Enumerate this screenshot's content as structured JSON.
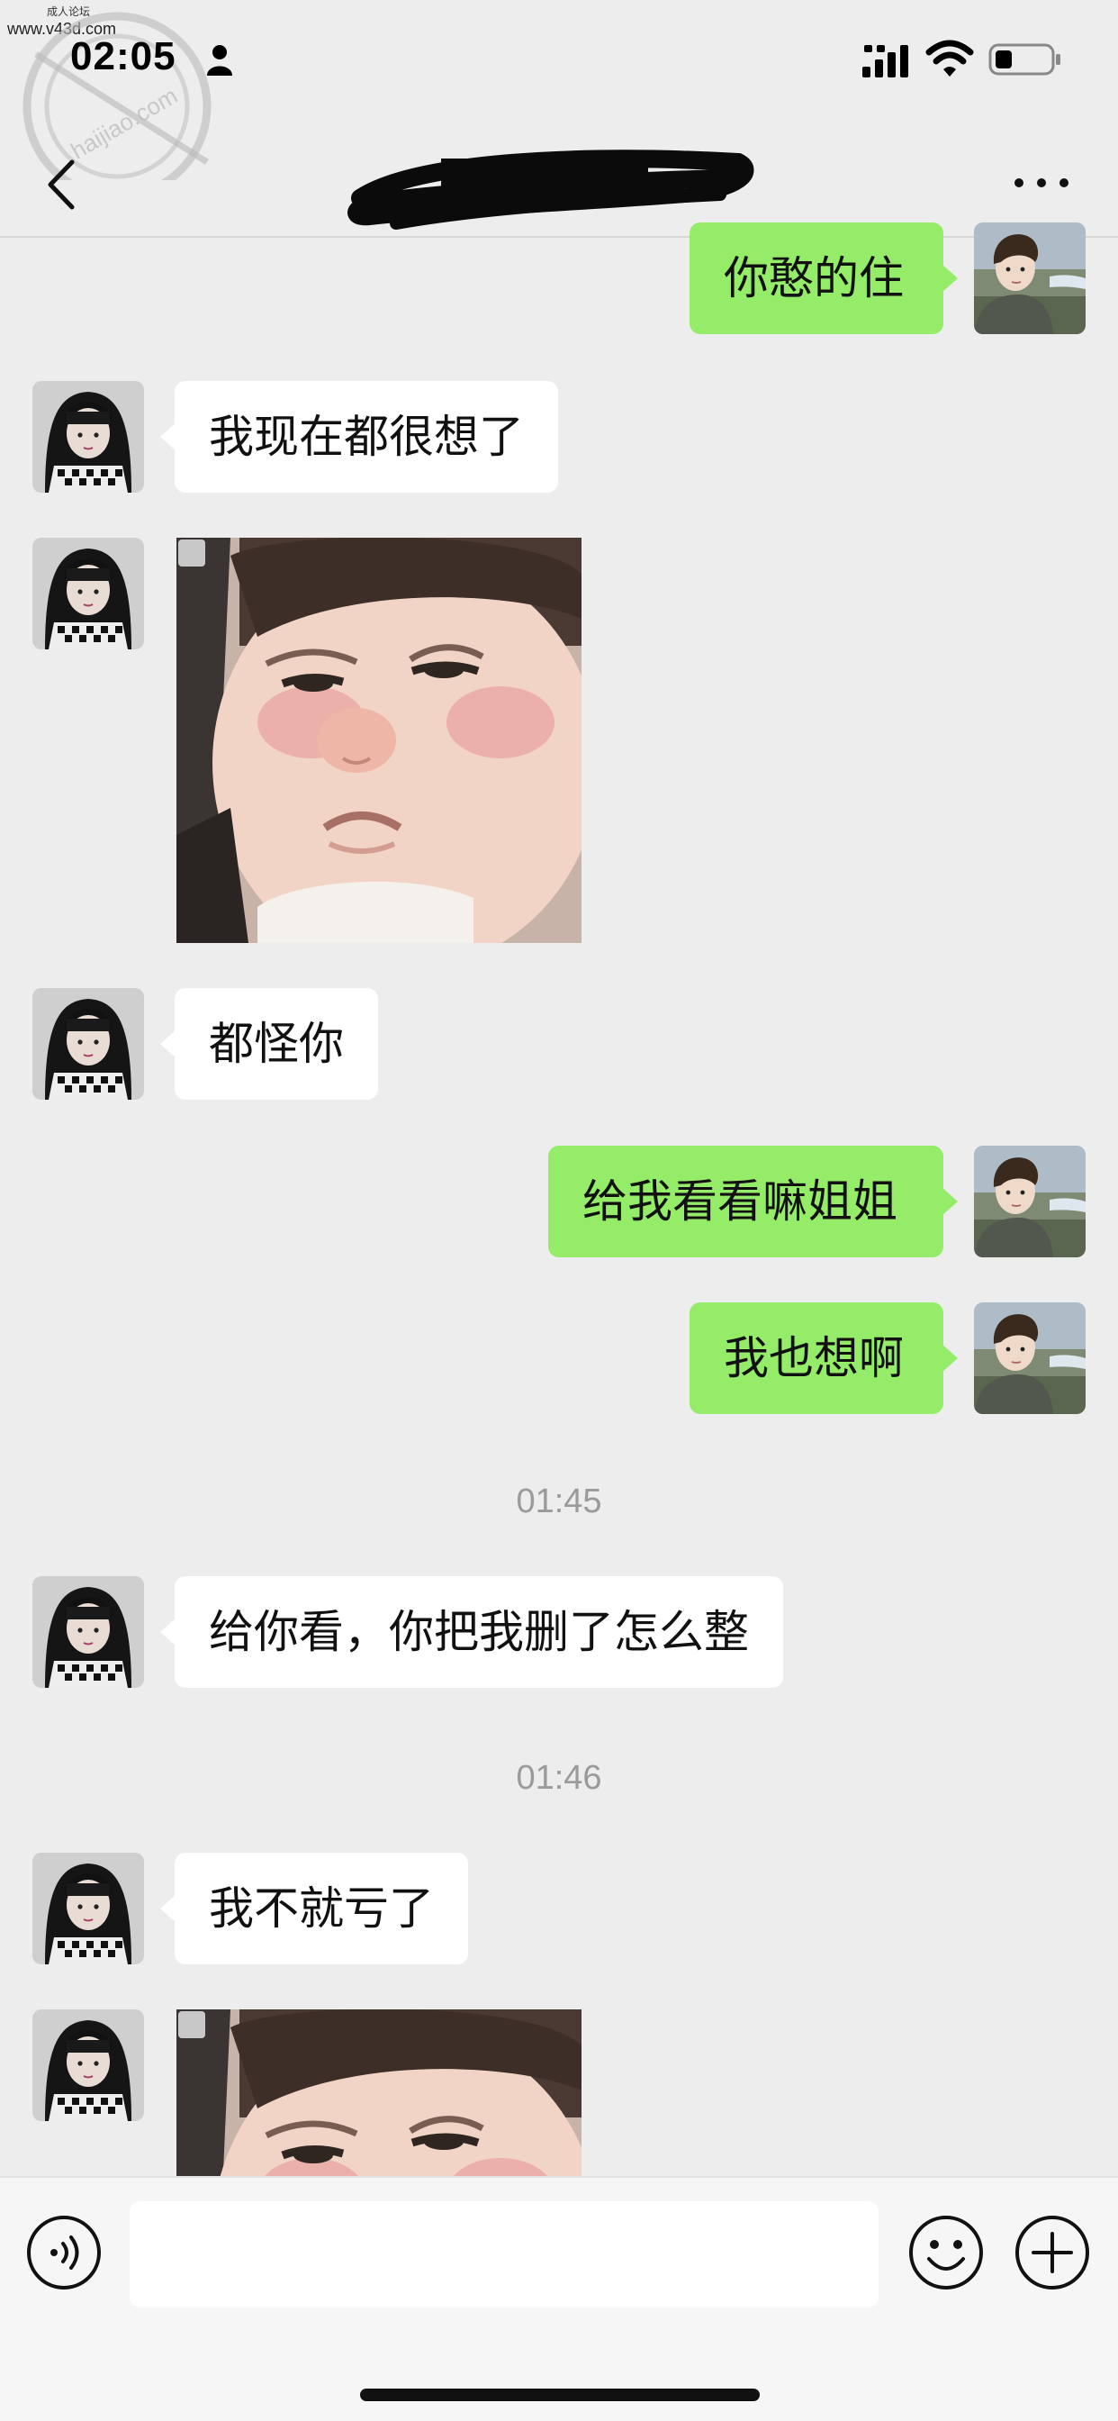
{
  "watermark": {
    "site": "www.v43d.com",
    "small_text": "成人论坛",
    "stamp_text": "haijiao.com"
  },
  "status_bar": {
    "time": "02:05"
  },
  "nav": {
    "title": "—",
    "back_icon": "chevron-left-icon",
    "more_icon": "ellipsis-icon"
  },
  "messages": [
    {
      "side": "right",
      "type": "text",
      "text": "你憨的住"
    },
    {
      "side": "left",
      "type": "text",
      "text": "我现在都很想了"
    },
    {
      "side": "left",
      "type": "sticker",
      "sticker": "crying-baby-sticker"
    },
    {
      "side": "left",
      "type": "text",
      "text": "都怪你"
    },
    {
      "side": "right",
      "type": "text",
      "text": "给我看看嘛姐姐"
    },
    {
      "side": "right",
      "type": "text",
      "text": "我也想啊"
    },
    {
      "type": "time",
      "text": "01:45"
    },
    {
      "side": "left",
      "type": "text",
      "text": "给你看，你把我删了怎么整"
    },
    {
      "type": "time",
      "text": "01:46"
    },
    {
      "side": "left",
      "type": "text",
      "text": "我不就亏了"
    },
    {
      "side": "left",
      "type": "sticker",
      "sticker": "crying-baby-sticker"
    }
  ],
  "input_bar": {
    "placeholder": "",
    "voice_icon": "voice-icon",
    "emoji_icon": "emoji-icon",
    "plus_icon": "plus-icon"
  },
  "colors": {
    "background": "#ededed",
    "outgoing_bubble": "#95ec69",
    "incoming_bubble": "#ffffff",
    "time_label": "#9a9a9a"
  }
}
